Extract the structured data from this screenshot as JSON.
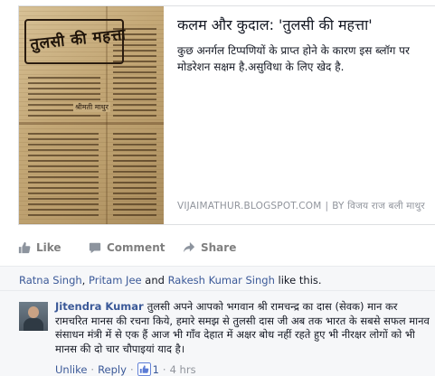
{
  "preview": {
    "thumbnail_masthead": "तुलसी की महत्ता",
    "thumbnail_byline": "श्रीमती माथुर",
    "title": "कलम और कुदाल: 'तुलसी की महत्ता'",
    "description": "कुछ अनर्गल टिप्पणियों के प्राप्त होने के कारण इस ब्लॉग पर मोडरेशन सक्षम है.असुविधा के लिए खेद है.",
    "domain": "VIJAIMATHUR.BLOGSPOT.COM",
    "separator": "|",
    "by_label": "BY",
    "author": "विजय राज बली माथुर"
  },
  "actions": {
    "like_label": "Like",
    "comment_label": "Comment",
    "share_label": "Share"
  },
  "likes": {
    "user1": "Ratna Singh",
    "comma": ",",
    "user2": "Pritam Jee",
    "and_text": "and",
    "user3": "Rakesh Kumar Singh",
    "suffix": "like this."
  },
  "comment": {
    "author": "Jitendra Kumar",
    "text": "तुलसी अपने आपको भगवान श्री रामचन्द्र का दास (सेवक) मान कर रामचरित मानस की रचना किये, हमारे समझ से तुलसी दास जी अब तक भारत के सबसे सफल मानव संसाधन मंत्री में से एक हैं आज भी गाँव देहात में अक्षर बोध नहीं रहते हुए भी नीरक्षर लोगों को भी मानस की दो चार चौपाइयां याद है।",
    "unlike_label": "Unlike",
    "dot": "·",
    "reply_label": "Reply",
    "like_count": "1",
    "time": "4 hrs"
  },
  "colors": {
    "link": "#3b5998",
    "muted": "#90949c",
    "background": "#f6f7f9"
  },
  "icons": [
    "thumbs-up-icon",
    "comment-bubble-icon",
    "share-arrow-icon",
    "small-thumbs-up-icon"
  ]
}
